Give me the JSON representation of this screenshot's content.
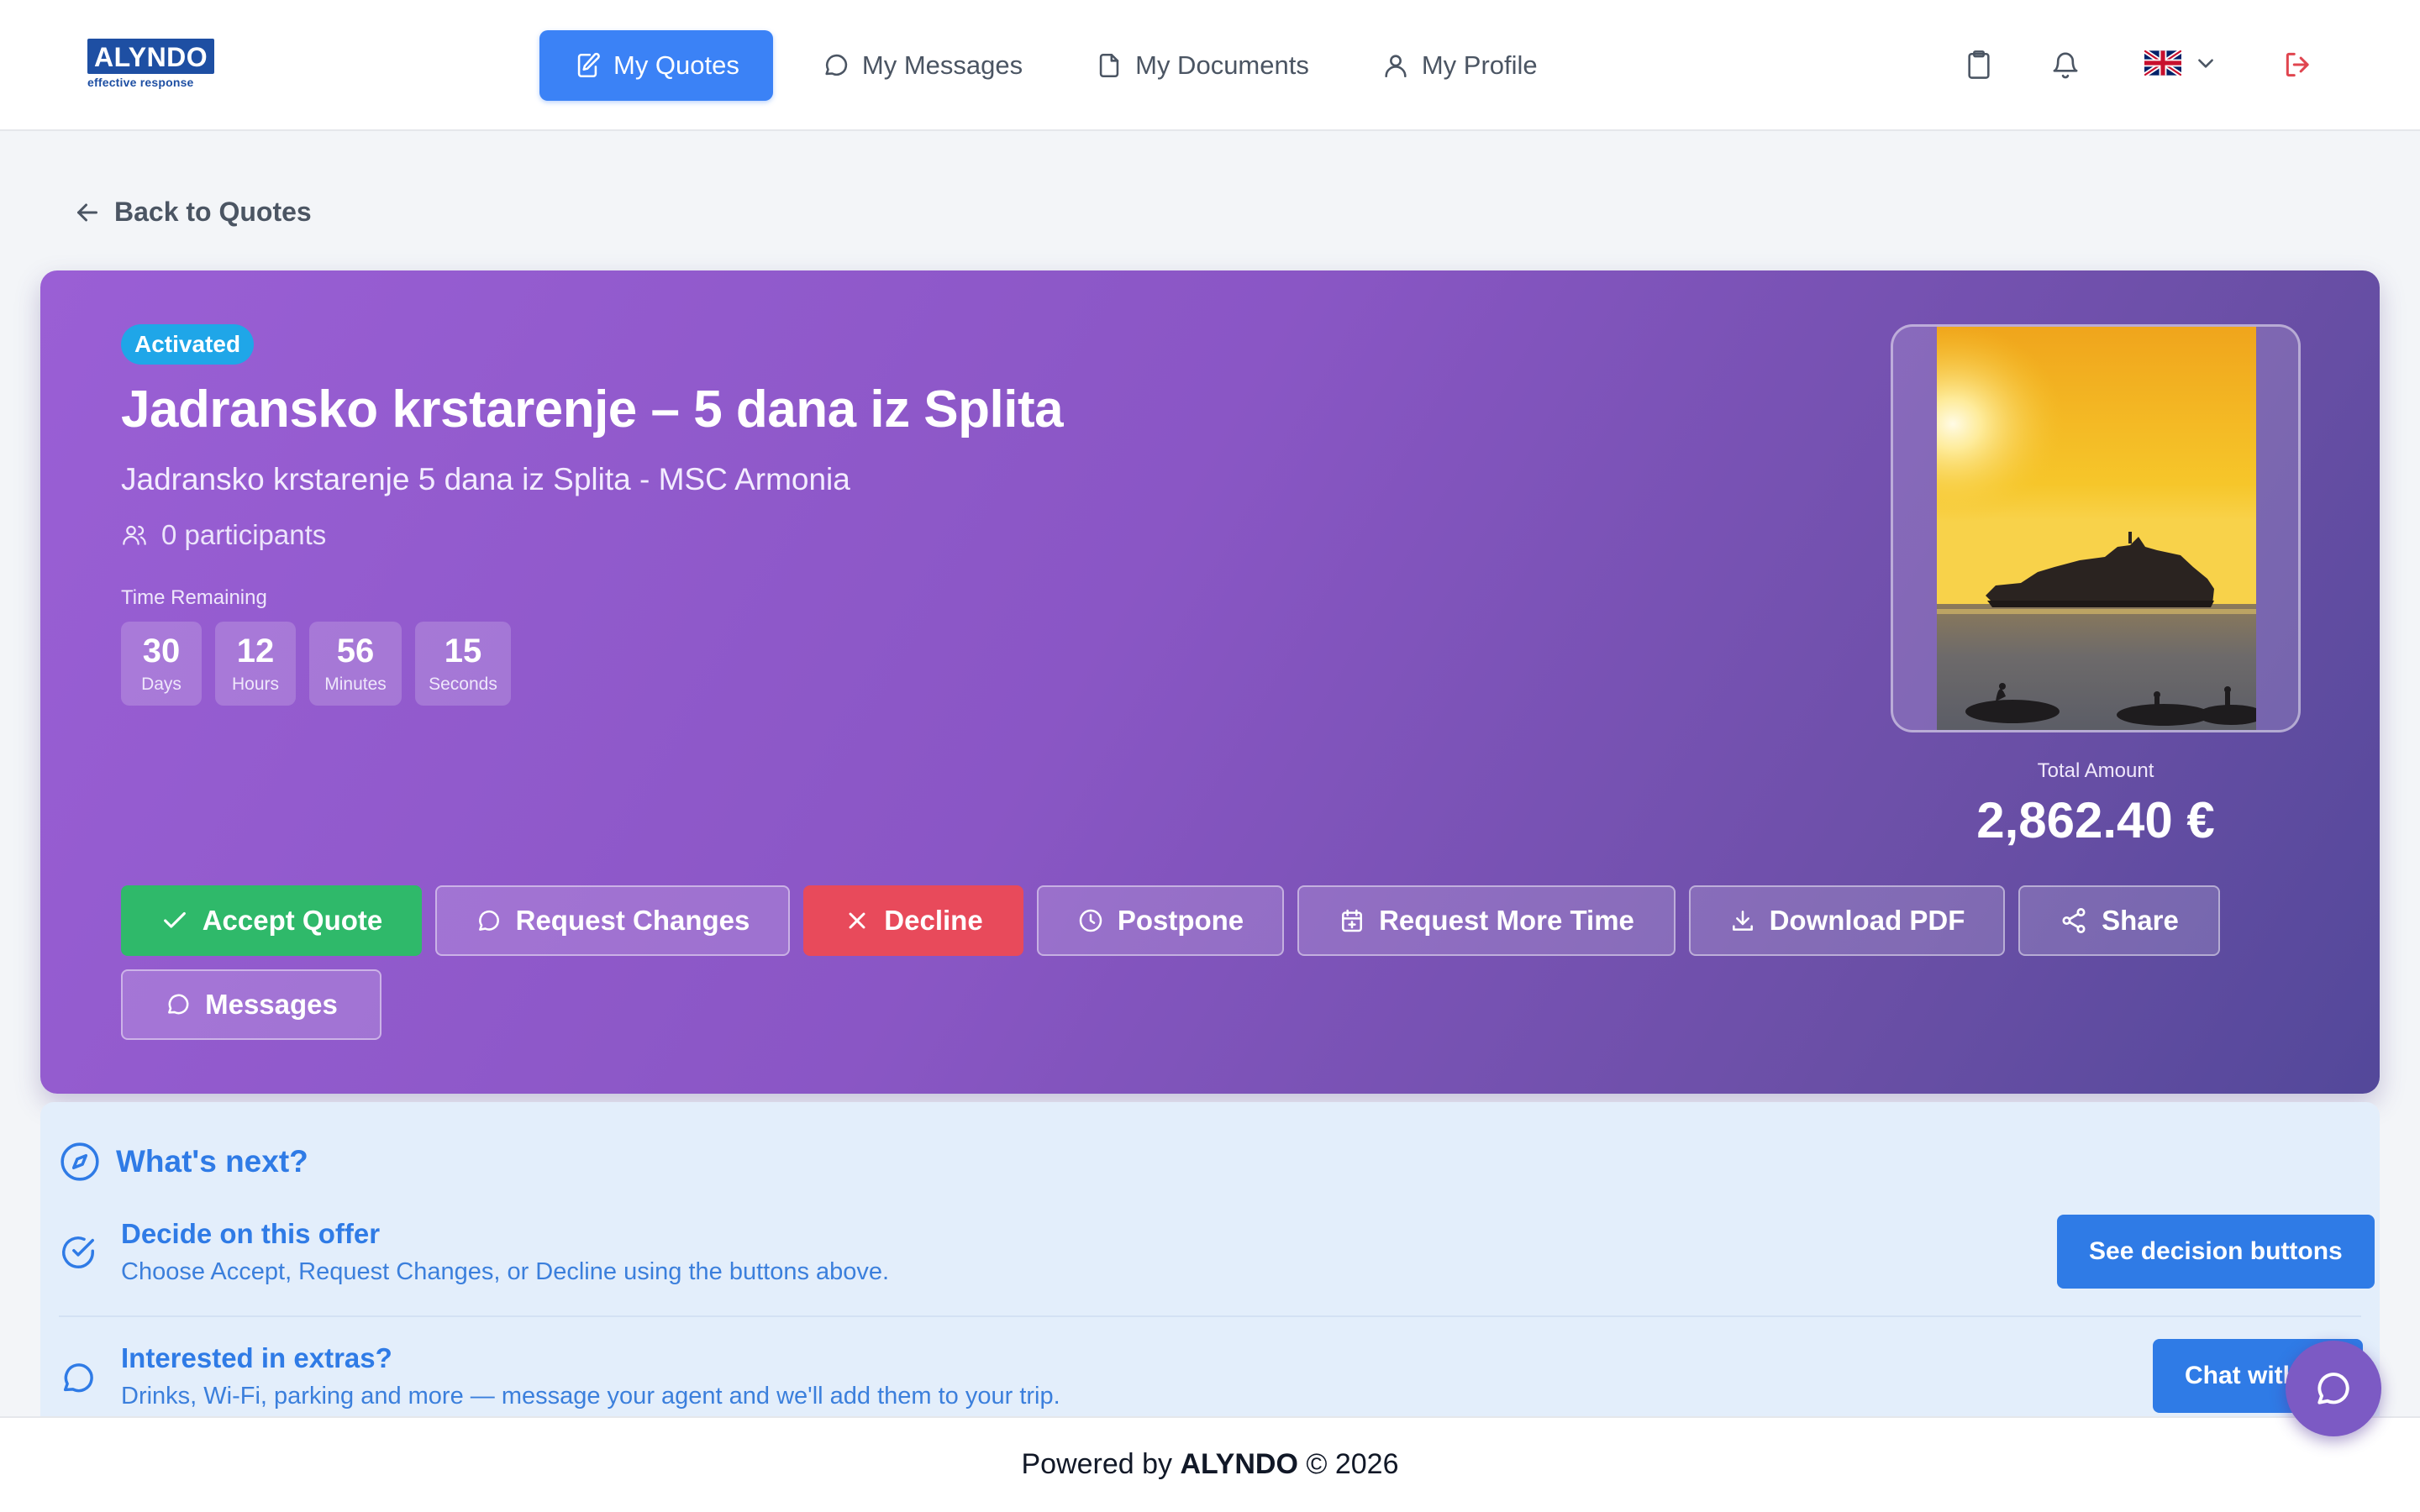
{
  "brand": {
    "name": "ALYNDO",
    "tagline": "effective response",
    "color": "#1e4fa3"
  },
  "nav": {
    "items": [
      {
        "label": "My Quotes",
        "icon": "edit-quote-icon",
        "active": true
      },
      {
        "label": "My Messages",
        "icon": "chat-icon",
        "active": false
      },
      {
        "label": "My Documents",
        "icon": "document-icon",
        "active": false
      },
      {
        "label": "My Profile",
        "icon": "user-icon",
        "active": false
      }
    ]
  },
  "header_icons": [
    "clipboard-icon",
    "bell-icon",
    "uk-flag-icon",
    "chevron-down-icon",
    "logout-icon"
  ],
  "back_link": "Back to Quotes",
  "quote": {
    "status": "Activated",
    "title": "Jadransko krstarenje – 5 dana iz Splita",
    "subtitle": "Jadransko krstarenje 5 dana iz Splita - MSC Armonia",
    "participants": "0 participants",
    "time_remaining_label": "Time Remaining",
    "countdown": [
      {
        "value": "30",
        "unit": "Days"
      },
      {
        "value": "12",
        "unit": "Hours"
      },
      {
        "value": "56",
        "unit": "Minutes"
      },
      {
        "value": "15",
        "unit": "Seconds"
      }
    ],
    "total_label": "Total Amount",
    "total_value": "2,862.40 €"
  },
  "actions": {
    "accept": "Accept Quote",
    "request_changes": "Request Changes",
    "decline": "Decline",
    "postpone": "Postpone",
    "request_more_time": "Request More Time",
    "download_pdf": "Download PDF",
    "share": "Share",
    "messages": "Messages"
  },
  "whats_next": {
    "title": "What's next?",
    "steps": [
      {
        "title": "Decide on this offer",
        "desc": "Choose Accept, Request Changes, or Decline using the buttons above.",
        "button": "See decision buttons"
      },
      {
        "title": "Interested in extras?",
        "desc": "Drinks, Wi-Fi, parking and more — message your agent and we'll add them to your trip.",
        "button": "Chat with"
      }
    ]
  },
  "footer": {
    "prefix": "Powered by ",
    "brand": "ALYNDO",
    "suffix": " © 2026"
  },
  "colors": {
    "primary": "#3b82f6",
    "accept": "#2fb96a",
    "decline": "#e84a5b",
    "hero_start": "#9a5fd5",
    "hero_end": "#53489a",
    "badge": "#1fa6e8",
    "logout": "#e0454f"
  }
}
